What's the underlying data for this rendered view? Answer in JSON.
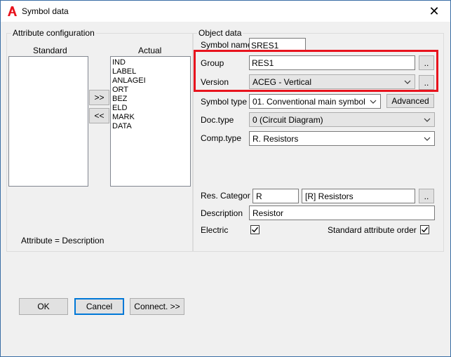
{
  "window": {
    "title": "Symbol data",
    "close_glyph": "✕",
    "accent_color": "#e8131d"
  },
  "attribute_config": {
    "title": "Attribute configuration",
    "standard_label": "Standard",
    "actual_label": "Actual",
    "standard_items": [],
    "actual_items": [
      "IND",
      "LABEL",
      "ANLAGEI",
      "ORT",
      "BEZ",
      "ELD",
      "MARK",
      "DATA"
    ],
    "add_button": ">>",
    "remove_button": "<<",
    "footer_text": "Attribute = Description"
  },
  "object_data": {
    "title": "Object data",
    "symbol_name": {
      "label": "Symbol name",
      "value": "SRES1"
    },
    "group": {
      "label": "Group",
      "value": "RES1",
      "browse": ".."
    },
    "version": {
      "label": "Version",
      "value": "ACEG - Vertical",
      "browse": ".."
    },
    "symbol_type": {
      "label": "Symbol type",
      "value": "01. Conventional main symbol",
      "advanced": "Advanced"
    },
    "doc_type": {
      "label": "Doc.type",
      "value": "0 (Circuit Diagram)"
    },
    "comp_type": {
      "label": "Comp.type",
      "value": "R. Resistors"
    },
    "res_categ": {
      "label": "Res. Categor",
      "code": "R",
      "name": "[R] Resistors",
      "browse": ".."
    },
    "description": {
      "label": "Description",
      "value": "Resistor"
    },
    "electric": {
      "label": "Electric",
      "checked": true
    },
    "standard_attr_order": {
      "label": "Standard attribute order",
      "checked": true
    }
  },
  "buttons": {
    "ok": "OK",
    "cancel": "Cancel",
    "connect": "Connect. >>"
  }
}
